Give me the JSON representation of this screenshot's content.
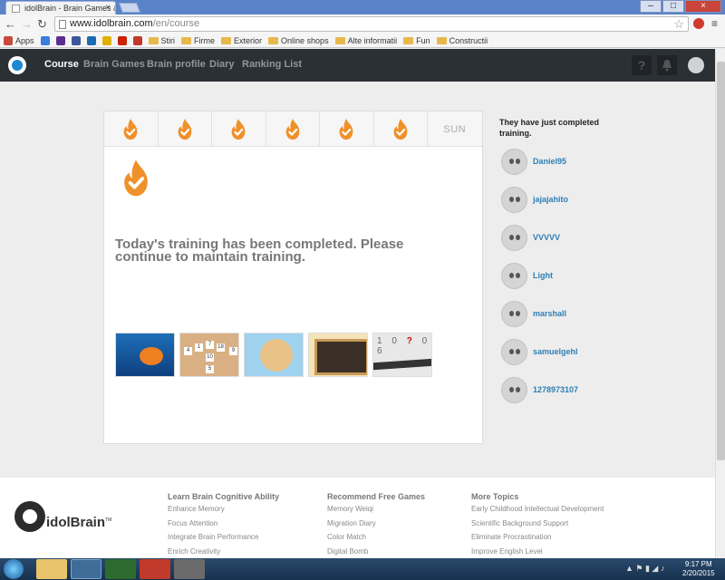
{
  "browser": {
    "tab_title": "idolBrain - Brain Games &",
    "url_host": "www.idolbrain.com",
    "url_path": "/en/course",
    "bookmarks": [
      {
        "label": "Apps",
        "color": "#c84a3a"
      },
      {
        "label": "",
        "color": "#3b7de0"
      },
      {
        "label": "",
        "color": "#5c2d91"
      },
      {
        "label": "",
        "color": "#3b5998"
      },
      {
        "label": "",
        "color": "#1a6bb3"
      },
      {
        "label": "",
        "color": "#e0b000"
      },
      {
        "label": "",
        "color": "#cc2200"
      },
      {
        "label": "",
        "color": "#c0392b"
      }
    ],
    "bookmark_folders": [
      "Stiri",
      "Firme",
      "Exterior",
      "Online shops",
      "Alte informatii",
      "Fun",
      "Constructii"
    ]
  },
  "nav": {
    "links": [
      "Course",
      "Brain Games",
      "Brain profile",
      "Diary",
      "Ranking List"
    ]
  },
  "week": {
    "completed_days": 6,
    "sun_label": "SUN"
  },
  "main": {
    "message": "Today's training has been completed. Please continue to maintain training."
  },
  "games": {
    "tiles2": [
      "4",
      "1",
      "7",
      "18",
      "9",
      "10",
      "5"
    ],
    "digits5_prefix": "1 0",
    "digits5_mark": "?",
    "digits5_suffix": "0 6"
  },
  "sidebar": {
    "title": "They have just completed training.",
    "users": [
      "Daniel95",
      "jajajahito",
      "VVVVV",
      "Light",
      "marshall",
      "samuelgehl",
      "1278973107"
    ]
  },
  "footer": {
    "brand": "idolBrain",
    "trademark": "TM",
    "columns": [
      {
        "heading": "Learn Brain Cognitive Ability",
        "links": [
          "Enhance Memory",
          "Focus Attention",
          "Integrate Brain Performance",
          "Enrich Creativity"
        ]
      },
      {
        "heading": "Recommend Free Games",
        "links": [
          "Memory Weiqi",
          "Migration Diary",
          "Color Match",
          "Digital Bomb"
        ]
      },
      {
        "heading": "More Topics",
        "links": [
          "Early Childhood Intellectual Development",
          "Scientific Background Support",
          "Eliminate Procrastination",
          "Improve English Level"
        ]
      }
    ]
  },
  "taskbar": {
    "time": "9:17 PM",
    "date": "2/20/2015"
  },
  "colors": {
    "flame": "#f0902a",
    "nav_bg": "#2b3035",
    "link": "#2e7fb6"
  },
  "icons": {
    "flame": "flame-check-icon",
    "help": "question-icon",
    "bell": "bell-icon",
    "avatar": "robot-avatar-icon"
  }
}
